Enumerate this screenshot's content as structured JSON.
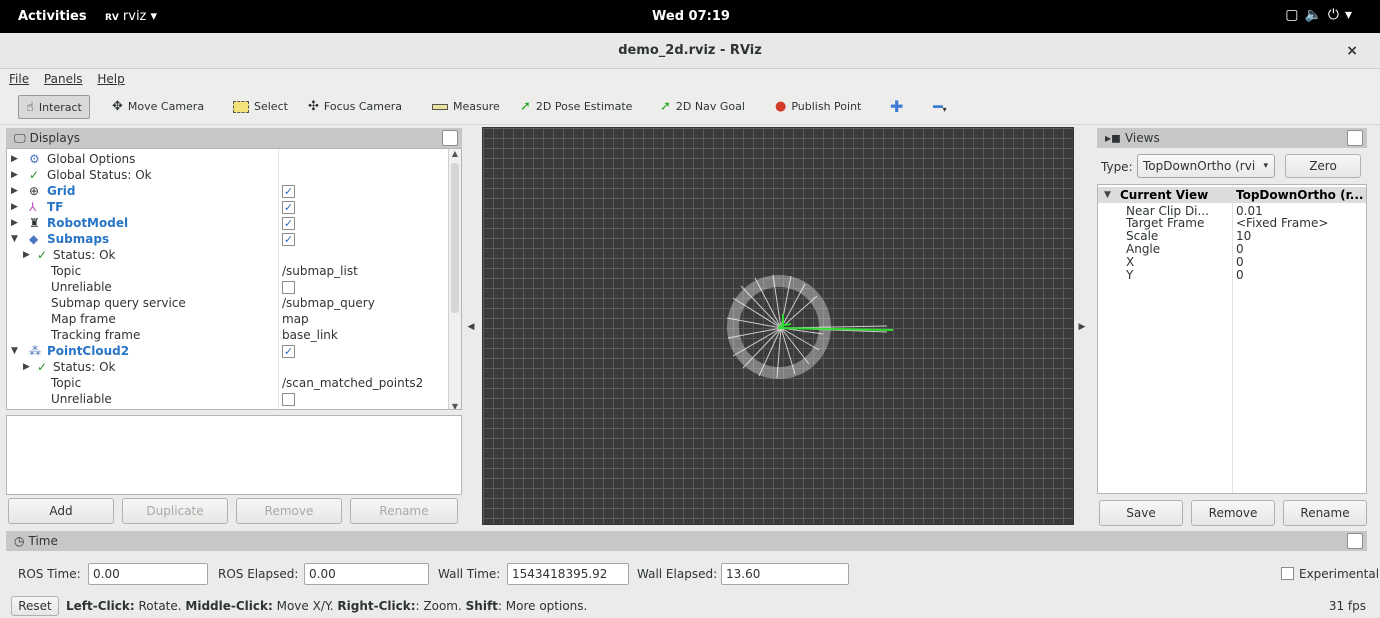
{
  "system_bar": {
    "activities": "Activities",
    "app_badge": "RV",
    "app_name": "rviz",
    "app_caret": "▾",
    "clock": "Wed 07:19",
    "tray_icons": [
      "window-icon",
      "volume-icon",
      "power-icon",
      "caret-icon"
    ]
  },
  "window": {
    "title": "demo_2d.rviz - RViz",
    "close": "×"
  },
  "menu": {
    "file": "File",
    "panels": "Panels",
    "help": "Help"
  },
  "toolbar": {
    "interact": "Interact",
    "move_camera": "Move Camera",
    "select": "Select",
    "focus_camera": "Focus Camera",
    "measure": "Measure",
    "pose_estimate": "2D Pose Estimate",
    "nav_goal": "2D Nav Goal",
    "publish_point": "Publish Point"
  },
  "displays": {
    "title": "Displays",
    "rows": {
      "global_options": "Global Options",
      "global_status": "Global Status: Ok",
      "grid": "Grid",
      "tf": "TF",
      "robot_model": "RobotModel",
      "submaps": "Submaps",
      "submaps_status": "Status: Ok",
      "topic_label": "Topic",
      "topic_value": "/submap_list",
      "unreliable_label": "Unreliable",
      "service_label": "Submap query service",
      "service_value": "/submap_query",
      "map_frame_label": "Map frame",
      "map_frame_value": "map",
      "tracking_label": "Tracking frame",
      "tracking_value": "base_link",
      "pointcloud": "PointCloud2",
      "pc_status": "Status: Ok",
      "pc_topic_label": "Topic",
      "pc_topic_value": "/scan_matched_points2",
      "pc_unreliable_label": "Unreliable"
    },
    "buttons": {
      "add": "Add",
      "duplicate": "Duplicate",
      "remove": "Remove",
      "rename": "Rename"
    }
  },
  "views": {
    "title": "Views",
    "type_label": "Type:",
    "type_value": "TopDownOrtho (rvi",
    "zero": "Zero",
    "current_view": "Current View",
    "current_value": "TopDownOrtho (r...",
    "props": [
      {
        "k": "Near Clip Di...",
        "v": "0.01"
      },
      {
        "k": "Target Frame",
        "v": "<Fixed Frame>"
      },
      {
        "k": "Scale",
        "v": "10"
      },
      {
        "k": "Angle",
        "v": "0"
      },
      {
        "k": "X",
        "v": "0"
      },
      {
        "k": "Y",
        "v": "0"
      }
    ],
    "buttons": {
      "save": "Save",
      "remove": "Remove",
      "rename": "Rename"
    }
  },
  "time": {
    "title": "Time",
    "ros_time_label": "ROS Time:",
    "ros_time": "0.00",
    "ros_elapsed_label": "ROS Elapsed:",
    "ros_elapsed": "0.00",
    "wall_time_label": "Wall Time:",
    "wall_time": "1543418395.92",
    "wall_elapsed_label": "Wall Elapsed:",
    "wall_elapsed": "13.60",
    "experimental": "Experimental"
  },
  "status": {
    "reset": "Reset",
    "hint_left": "Left-Click:",
    "hint_left_txt": " Rotate. ",
    "hint_middle": "Middle-Click:",
    "hint_middle_txt": " Move X/Y. ",
    "hint_right": "Right-Click:",
    "hint_right_txt": ": Zoom. ",
    "hint_shift": "Shift",
    "hint_shift_txt": ": More options.",
    "fps": "31 fps"
  }
}
